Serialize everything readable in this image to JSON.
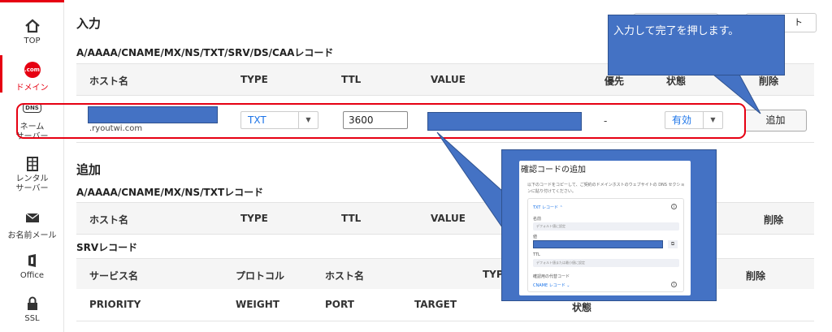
{
  "sidebar": {
    "items": [
      {
        "label": "TOP",
        "icon": "home-icon"
      },
      {
        "label": "ドメイン",
        "icon": "dotcom-icon",
        "badge": ".com"
      },
      {
        "label": "ネーム\nサーバー",
        "icon": "dns-icon",
        "badge": "DNS"
      },
      {
        "label": "レンタル\nサーバー",
        "icon": "server-icon"
      },
      {
        "label": "お名前メール",
        "icon": "mail-icon"
      },
      {
        "label": "Office",
        "icon": "office-icon"
      },
      {
        "label": "SSL",
        "icon": "lock-icon"
      }
    ],
    "accent": "#e60012"
  },
  "input_section": {
    "title": "入力",
    "subtitle": "A/AAAA/CNAME/MX/NS/TXT/SRV/DS/CAAレコード",
    "headers": [
      "ホスト名",
      "TYPE",
      "TTL",
      "VALUE",
      "優先",
      "状態",
      "削除"
    ],
    "row": {
      "domain_suffix": ".ryoutwi.com",
      "type_value": "TXT",
      "ttl_value": "3600",
      "priority": "-",
      "status_value": "有効",
      "add_label": "追加"
    },
    "top_button_right_label": "ト"
  },
  "add_section": {
    "title": "追加",
    "subtitle": "A/AAAA/CNAME/MX/NS/TXTレコード",
    "headers": [
      "ホスト名",
      "TYPE",
      "TTL",
      "VALUE",
      "削除"
    ]
  },
  "srv_section": {
    "title": "SRVレコード",
    "headers": [
      "サービス名",
      "プロトコル",
      "ホスト名",
      "TYP",
      "削除"
    ],
    "row2": [
      "PRIORITY",
      "WEIGHT",
      "PORT",
      "TARGET",
      "状態"
    ]
  },
  "callout": {
    "text": "入力して完了を押します。",
    "color": "#4472c4"
  },
  "dialog": {
    "title": "確認コードの追加",
    "description": "以下のコードをコピーして、ご契約のドメインホストのウェブサイトの DNS セクションに貼り付けてください。",
    "txt_record_label": "TXT レコード",
    "name_label": "名前",
    "name_placeholder": "デフォルト値に設定",
    "value_label": "値",
    "ttl_label": "TTL",
    "ttl_placeholder": "デフォルト値または最小値に設定",
    "alt_code_label": "確認用の代替コード",
    "cname_label": "CNAME レコード"
  }
}
